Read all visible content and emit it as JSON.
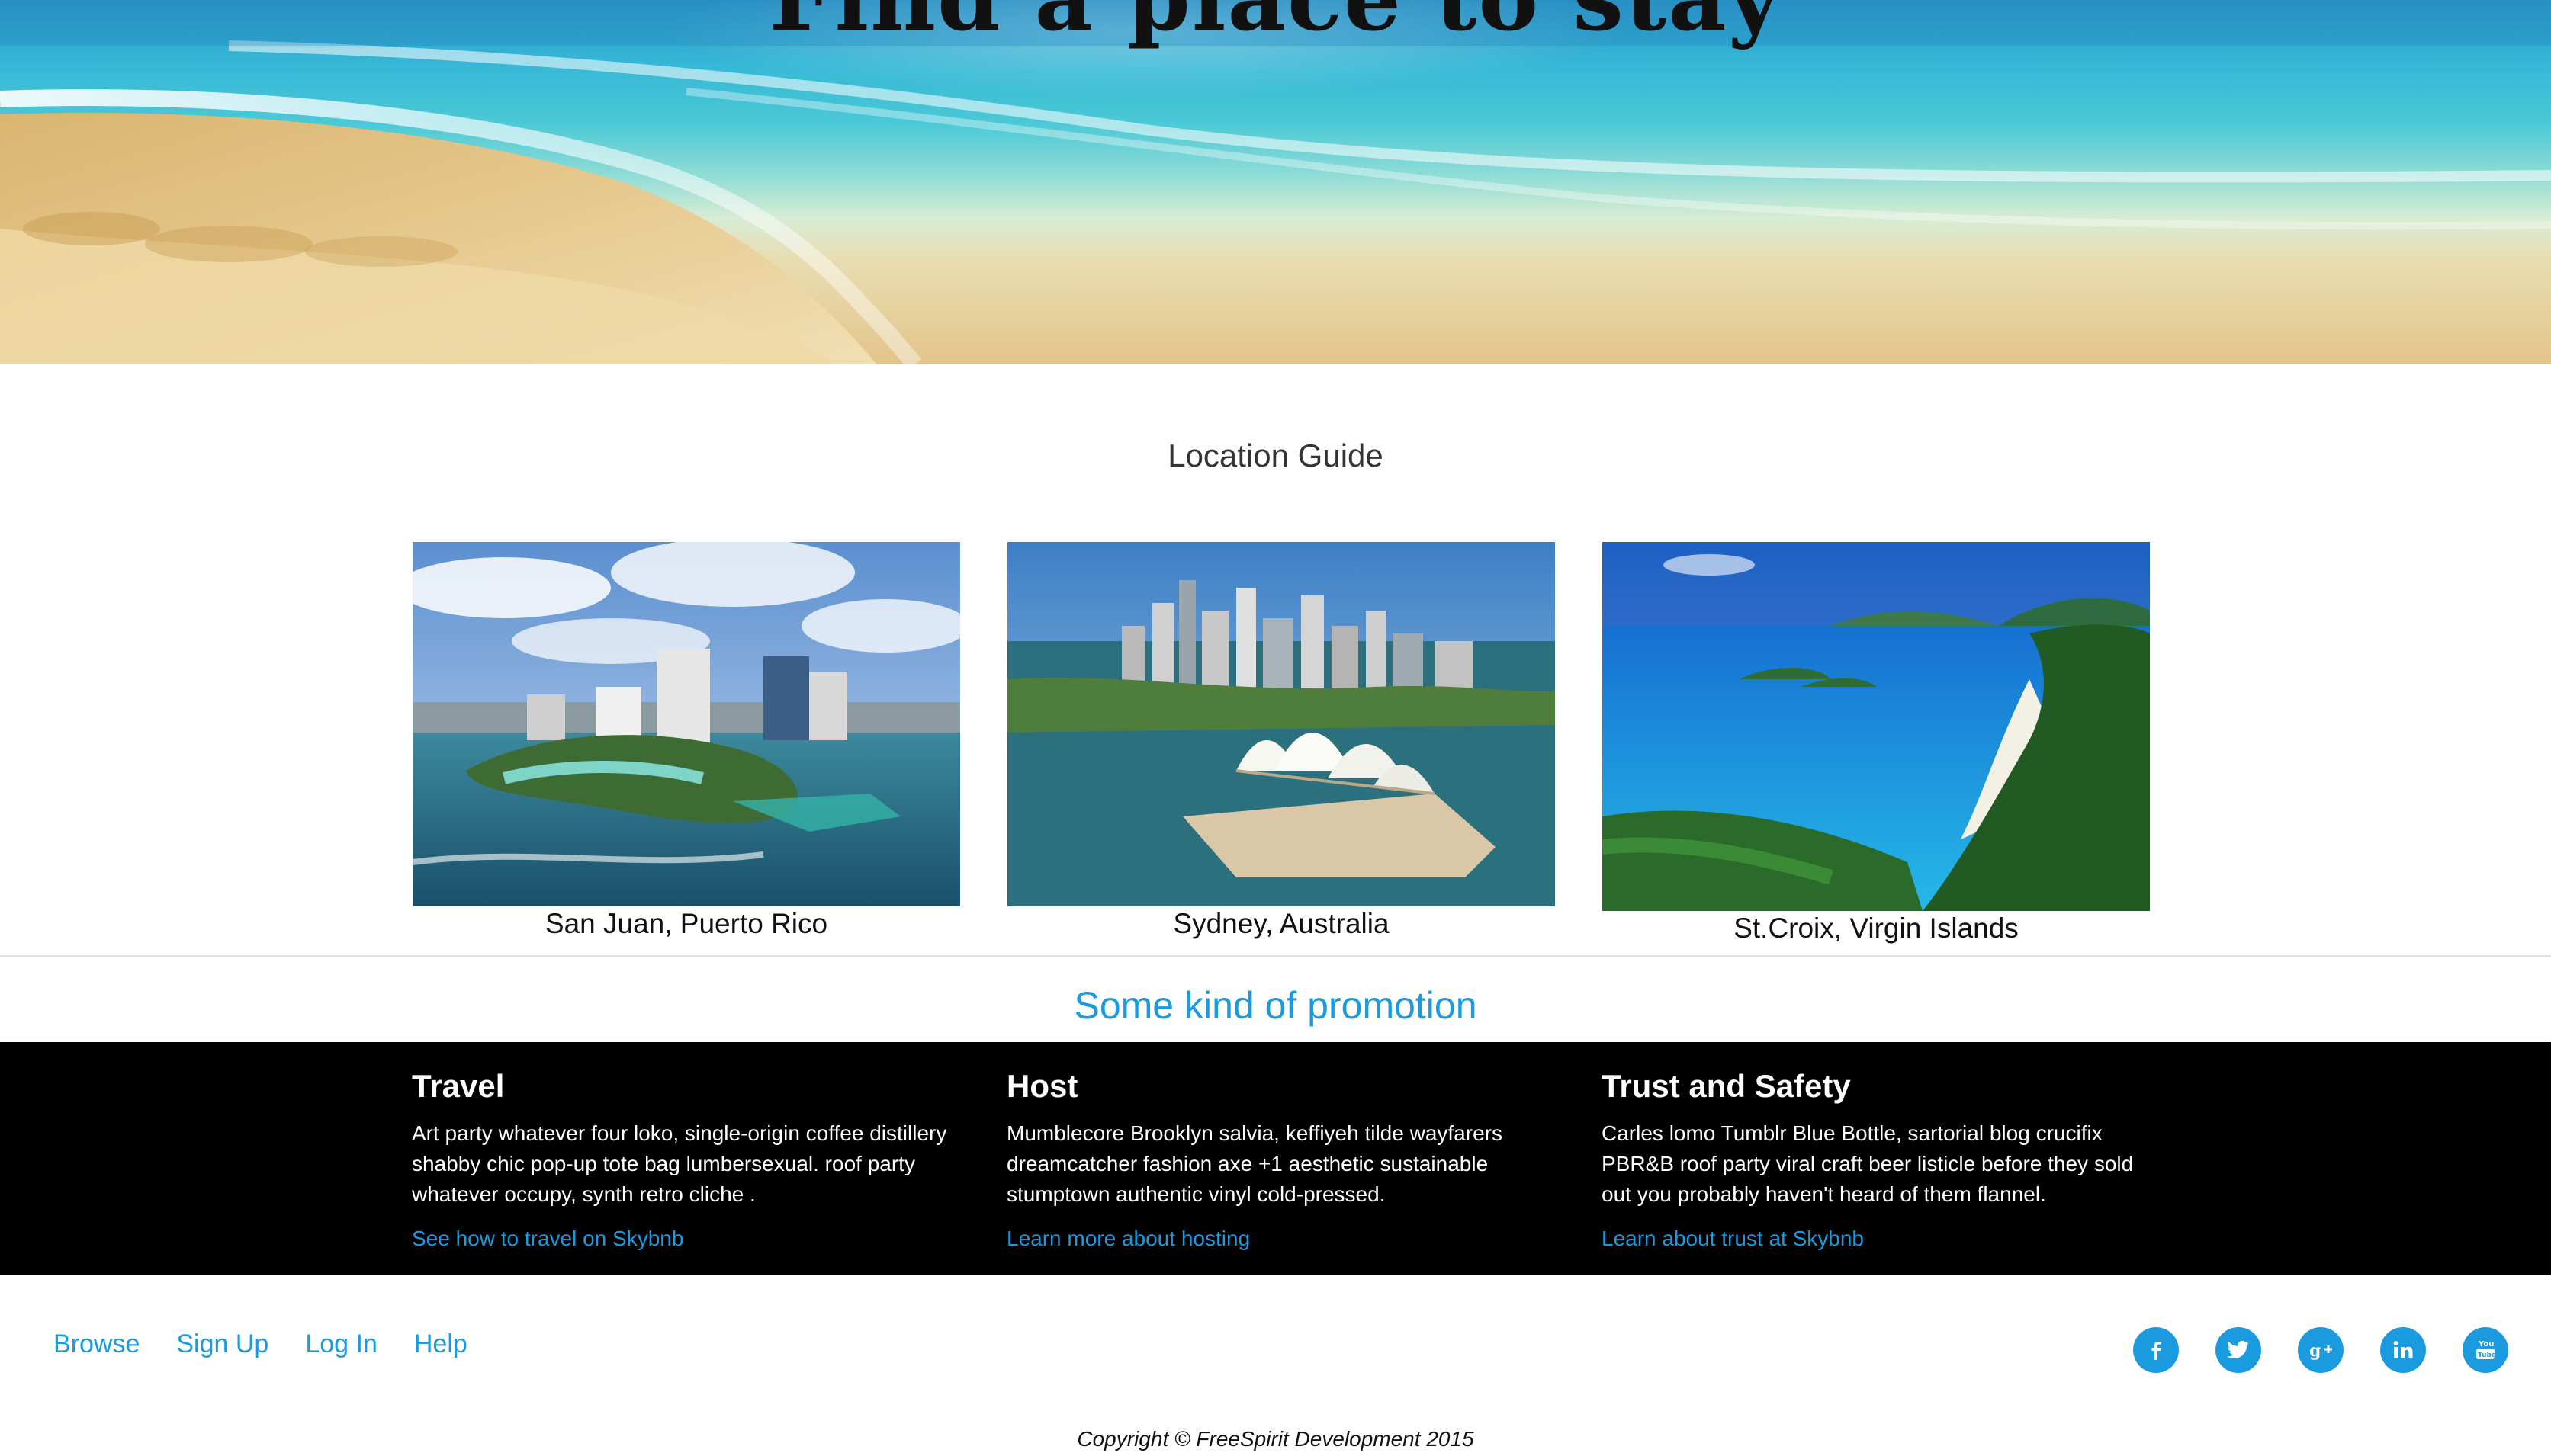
{
  "hero": {
    "title": "Find a place to stay"
  },
  "location_guide": {
    "title": "Location Guide",
    "items": [
      {
        "caption": "San Juan, Puerto Rico"
      },
      {
        "caption": "Sydney, Australia"
      },
      {
        "caption": "St.Croix, Virgin Islands"
      }
    ]
  },
  "promotion": {
    "text": "Some kind of promotion"
  },
  "info": {
    "travel": {
      "heading": "Travel",
      "body": "Art party whatever four loko, single-origin coffee distillery shabby chic pop-up tote bag lumbersexual. roof party whatever occupy, synth retro cliche .",
      "link": "See how to travel on Skybnb"
    },
    "host": {
      "heading": "Host",
      "body": "Mumblecore Brooklyn salvia, keffiyeh tilde wayfarers dreamcatcher fashion axe +1 aesthetic sustainable stumptown authentic vinyl cold-pressed.",
      "link": "Learn more about hosting"
    },
    "trust": {
      "heading": "Trust and Safety",
      "body": "Carles lomo Tumblr Blue Bottle, sartorial blog crucifix PBR&B roof party viral craft beer listicle before they sold out you probably haven't heard of them flannel.",
      "link": "Learn about trust at Skybnb"
    }
  },
  "footer": {
    "nav": {
      "browse": "Browse",
      "signup": "Sign Up",
      "login": "Log In",
      "help": "Help"
    },
    "social": [
      "facebook-icon",
      "twitter-icon",
      "google-plus-icon",
      "linkedin-icon",
      "youtube-icon"
    ],
    "copyright": "Copyright © FreeSpirit Development 2015"
  },
  "colors": {
    "accent": "#1a9be0",
    "band": "#000000"
  }
}
